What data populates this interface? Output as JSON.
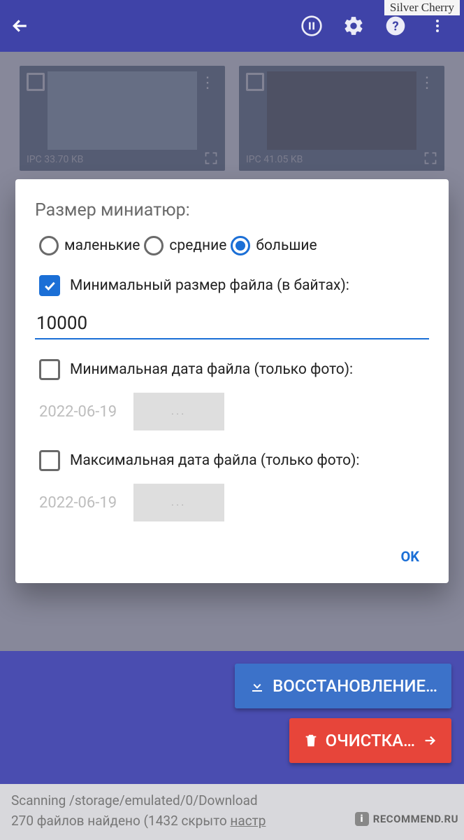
{
  "watermark_top": "Silver Cherry",
  "watermark_bottom": "RECOMMEND.RU",
  "thumbs": [
    {
      "label": "IPC  33.70 KB"
    },
    {
      "label": "IPC  41.05 KB"
    }
  ],
  "dialog": {
    "title": "Размер миниатюр:",
    "radios": {
      "small": "маленькие",
      "medium": "средние",
      "large": "большие",
      "selected": "large"
    },
    "min_size": {
      "label": "Минимальный размер файла (в байтах):",
      "checked": true,
      "value": "10000"
    },
    "min_date": {
      "label": "Минимальная дата файла (только фото):",
      "checked": false,
      "value": "2022-06-19",
      "button": "..."
    },
    "max_date": {
      "label": "Максимальная дата файла (только фото):",
      "checked": false,
      "value": "2022-06-19",
      "button": "..."
    },
    "ok": "OK"
  },
  "buttons": {
    "restore": "ВОССТАНОВЛЕНИЕ…",
    "clear": "ОЧИСТКА…"
  },
  "status": {
    "line1": "Scanning /storage/emulated/0/Download",
    "line2_a": "270 файлов найдено (1432 скрыто ",
    "line2_link": "настр",
    "line2_b": ""
  }
}
